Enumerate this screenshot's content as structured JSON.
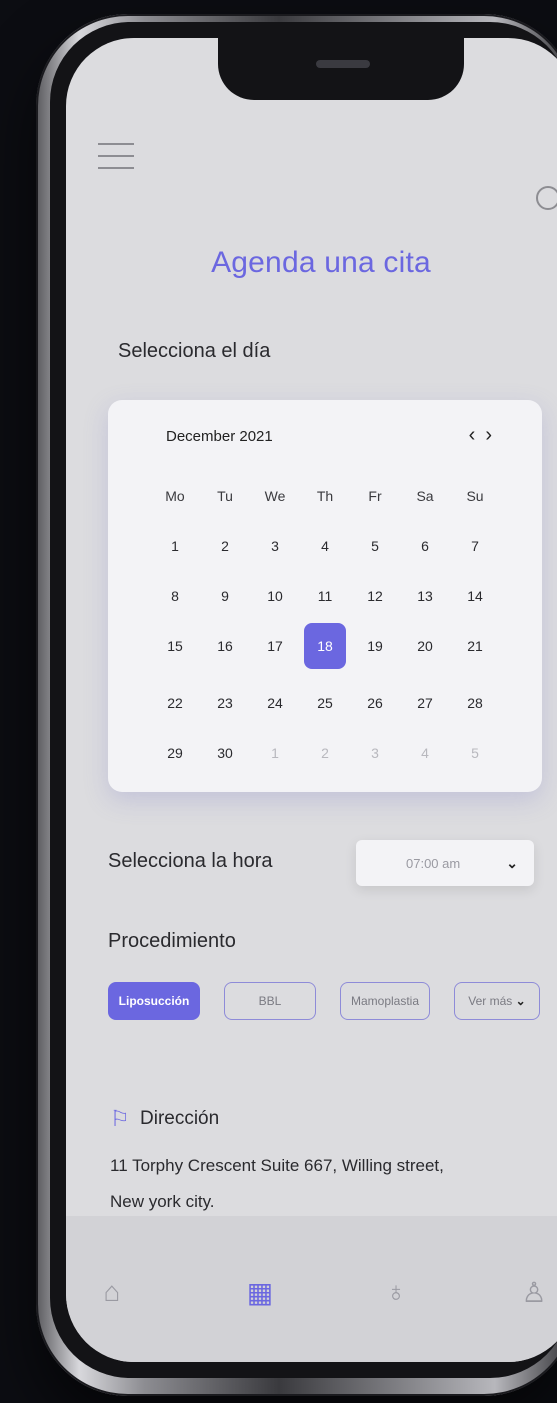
{
  "header": {
    "title": "Agenda una cita",
    "menu_icon": "menu-icon",
    "search_icon": "search-icon"
  },
  "day_section": {
    "label": "Selecciona el día",
    "calendar": {
      "month": "December 2021",
      "prev_icon": "chevron-left-icon",
      "next_icon": "chevron-right-icon",
      "weekdays": [
        "Mo",
        "Tu",
        "We",
        "Th",
        "Fr",
        "Sa",
        "Su"
      ],
      "weeks": [
        [
          "1",
          "2",
          "3",
          "4",
          "5",
          "6",
          "7"
        ],
        [
          "8",
          "9",
          "10",
          "11",
          "12",
          "13",
          "14"
        ],
        [
          "15",
          "16",
          "17",
          "18",
          "19",
          "20",
          "21"
        ],
        [
          "22",
          "23",
          "24",
          "25",
          "26",
          "27",
          "28"
        ],
        [
          "29",
          "30",
          "1",
          "2",
          "3",
          "4",
          "5"
        ]
      ],
      "selected_day": "18",
      "accent_color": "#6b67e0"
    }
  },
  "time_section": {
    "label": "Selecciona la hora",
    "selected_value": "07:00 am"
  },
  "procedure_section": {
    "label": "Procedimiento",
    "chips": [
      "Liposucción",
      "BBL",
      "Mamoplastia",
      "Ver más"
    ],
    "active_chip": "Liposucción"
  },
  "address": {
    "icon": "signpost-icon",
    "label": "Dirección",
    "line1": "11 Torphy Crescent Suite 667, Willing street,",
    "line2": "New york city."
  },
  "bottom_nav": {
    "items": [
      "home-icon",
      "calendar-icon",
      "stethoscope-icon",
      "user-icon"
    ],
    "active": "calendar-icon"
  }
}
